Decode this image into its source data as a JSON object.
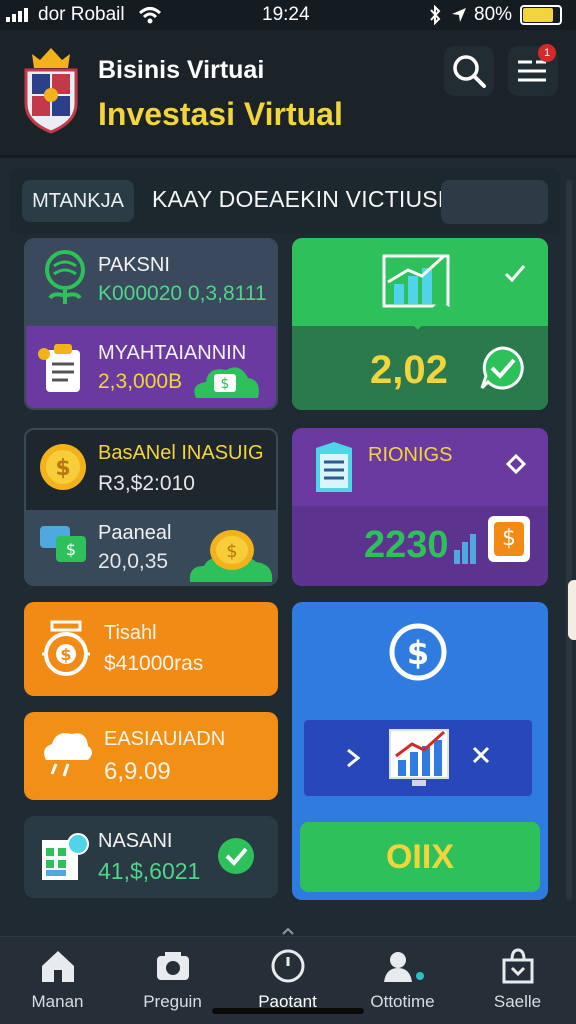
{
  "status_bar": {
    "carrier": "dor Robail",
    "time": "19:24",
    "battery": "80%"
  },
  "header": {
    "title": "Bisinis Virtuai",
    "subtitle": "Investasi Virtual",
    "notification_count": "1"
  },
  "filter": {
    "chip_label": "MTANKJA",
    "title": "KAAY DOEAEKIN VICTIUSH"
  },
  "cards": {
    "paksni": {
      "label": "PAKSNI",
      "value": "K000020 0,3,8111"
    },
    "myahtaiannin": {
      "label": "MYAHTAIANNIN",
      "value": "2,3,000B"
    },
    "growth": {
      "value": "2,02"
    },
    "basanel": {
      "label": "BasANel INASUIG",
      "value": "R3,$2:010"
    },
    "paaneal": {
      "label": "Paaneal",
      "value": "20,0,35"
    },
    "rionigs": {
      "label": "RIONIGS",
      "value": "2230"
    },
    "tisahh": {
      "label": "Tisahl",
      "value": "$41000ras"
    },
    "easiauidn": {
      "label": "EASIAUIADN",
      "value": "6,9.09"
    },
    "nasani": {
      "label": "NASANI",
      "value": "41,$,6021"
    },
    "blue": {
      "button_label": "OIIX"
    }
  },
  "nav": {
    "items": [
      {
        "label": "Manan",
        "icon": "home-icon"
      },
      {
        "label": "Preguin",
        "icon": "camera-icon"
      },
      {
        "label": "Paotant",
        "icon": "clock-icon"
      },
      {
        "label": "Ottotime",
        "icon": "person-icon"
      },
      {
        "label": "Saelle",
        "icon": "bag-icon"
      }
    ]
  },
  "colors": {
    "accent_yellow": "#f2d53c",
    "green": "#2ec05b",
    "purple": "#6b3aa0",
    "orange": "#f28a16",
    "blue": "#2f7be0"
  }
}
